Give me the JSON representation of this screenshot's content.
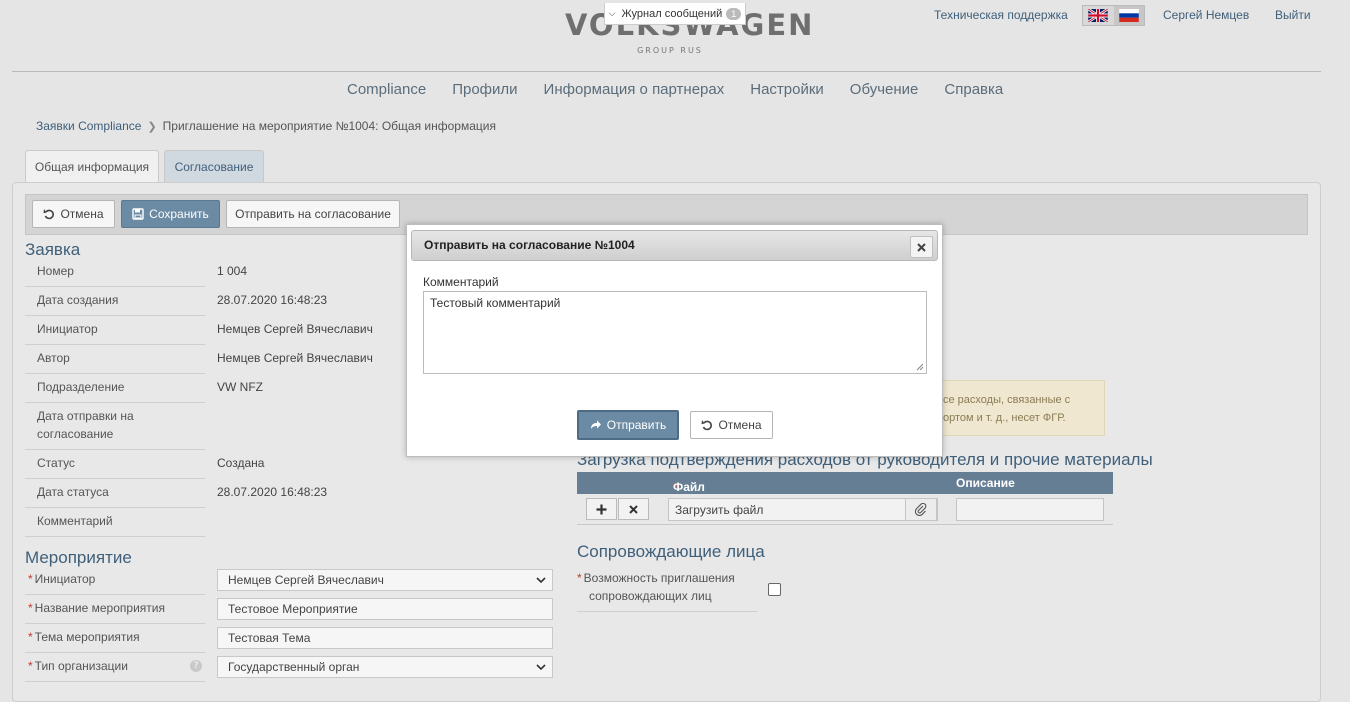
{
  "header": {
    "brand": "VOLKSWAGEN",
    "brand_sub": "GROUP RUS",
    "journal": {
      "label": "Журнал сообщений",
      "count": "1"
    },
    "support": "Техническая поддержка",
    "user": "Сергей Немцев",
    "logout": "Выйти",
    "languages": [
      "en",
      "ru"
    ]
  },
  "menu": [
    "Compliance",
    "Профили",
    "Информация о партнерах",
    "Настройки",
    "Обучение",
    "Справка"
  ],
  "breadcrumb": {
    "parent": "Заявки Compliance",
    "current": "Приглашение на мероприятие №1004: Общая информация"
  },
  "tabs": [
    "Общая информация",
    "Согласование"
  ],
  "toolbar": {
    "cancel": "Отмена",
    "save": "Сохранить",
    "send": "Отправить на согласование"
  },
  "request": {
    "title": "Заявка",
    "rows": [
      {
        "label": "Номер",
        "value": "1 004"
      },
      {
        "label": "Дата создания",
        "value": "28.07.2020 16:48:23"
      },
      {
        "label": "Инициатор",
        "value": "Немцев Сергей Вячеславич"
      },
      {
        "label": "Автор",
        "value": "Немцев Сергей Вячеславич"
      },
      {
        "label": "Подразделение",
        "value": "VW NFZ"
      },
      {
        "label": "Дата отправки на",
        "label2": "согласование",
        "value": ""
      },
      {
        "label": "Статус",
        "value": "Создана"
      },
      {
        "label": "Дата статуса",
        "value": "28.07.2020 16:48:23"
      },
      {
        "label": "Комментарий",
        "value": ""
      }
    ]
  },
  "event": {
    "title": "Мероприятие",
    "fields": [
      {
        "label": "Инициатор",
        "value": "Немцев Сергей Вячеславич"
      },
      {
        "label": "Название мероприятия",
        "value": "Тестовое Мероприятие"
      },
      {
        "label": "Тема мероприятия",
        "value": "Тестовая Тема"
      },
      {
        "label": "Тип организации",
        "value": "Государственный орган"
      }
    ],
    "help_glyph": "?"
  },
  "notice": {
    "line1": "се расходы, связанные с",
    "line2": "ортом и т. д., несет ФГР."
  },
  "upload_section": {
    "title": "Загрузка подтверждения расходов от руководителя и прочие материалы",
    "col_file": "Файл",
    "col_desc": "Описание",
    "upload_label": "Загрузить файл"
  },
  "companions": {
    "title": "Сопровождающие лица",
    "label1": "Возможность приглашения",
    "label2": "сопровождающих лиц",
    "checked": false
  },
  "modal": {
    "title": "Отправить на согласование №1004",
    "comment_label": "Комментарий",
    "comment_value": "Тестовый комментарий",
    "submit": "Отправить",
    "cancel": "Отмена"
  },
  "colors": {
    "accent": "#3f5f7a",
    "primary_button": "#6b8aa4",
    "table_header": "#657e93",
    "required": "#c0392b"
  }
}
